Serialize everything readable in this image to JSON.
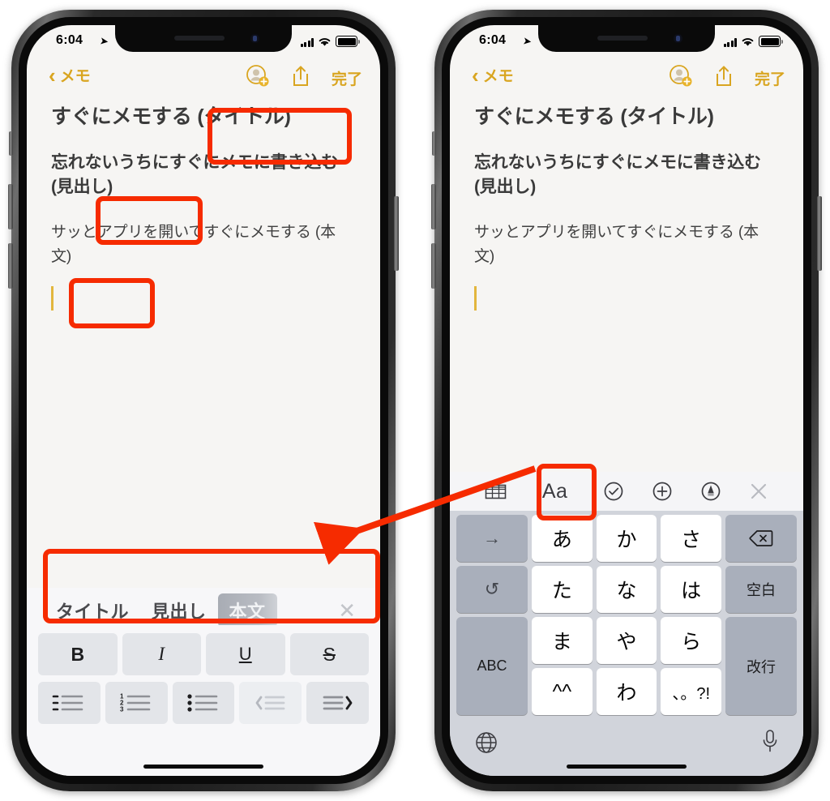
{
  "meta": {
    "device": "iPhone X",
    "app": "メモ",
    "accent_color": "#d9a520",
    "highlight_color": "#f62b00",
    "screens": 2
  },
  "status_bar": {
    "time": "6:04",
    "location_icon": "location-arrow-icon",
    "signal_icon": "cellular-bars-icon",
    "wifi_icon": "wifi-icon",
    "battery_icon": "battery-full-icon"
  },
  "nav_bar": {
    "back_label": "メモ",
    "back_icon": "chevron-left-icon",
    "add_person_icon": "person-add-icon",
    "share_icon": "share-icon",
    "done_label": "完了"
  },
  "note": {
    "title": "すぐにメモする (タイトル)",
    "heading": "忘れないうちにすぐにメモに書き込む (見出し)",
    "body": "サッとアプリを開いてすぐにメモする (本文)",
    "caret": "text-caret"
  },
  "left_screen": {
    "format_bar": {
      "styles": [
        {
          "label": "タイトル",
          "selected": false
        },
        {
          "label": "見出し",
          "selected": false
        },
        {
          "label": "本文",
          "selected": true
        }
      ],
      "close_icon": "close-icon"
    },
    "style_keyboard": {
      "row1": [
        {
          "label": "B",
          "name": "bold-button",
          "style": "bold"
        },
        {
          "label": "I",
          "name": "italic-button",
          "style": "italic"
        },
        {
          "label": "U",
          "name": "underline-button",
          "style": "underline"
        },
        {
          "label": "S",
          "name": "strikethrough-button",
          "style": "strike"
        }
      ],
      "row2": [
        {
          "name": "bulleted-list-button",
          "icon": "dash-list-icon"
        },
        {
          "name": "numbered-list-button",
          "icon": "numbered-list-icon"
        },
        {
          "name": "dotted-list-button",
          "icon": "bullet-list-icon"
        },
        {
          "name": "outdent-button",
          "icon": "indent-left-icon"
        },
        {
          "name": "indent-button",
          "icon": "indent-right-icon"
        }
      ]
    }
  },
  "right_screen": {
    "accessory_bar": [
      {
        "name": "table-button",
        "icon": "table-icon",
        "label": ""
      },
      {
        "name": "text-format-button",
        "icon": "aa-icon",
        "label": "Aa"
      },
      {
        "name": "checklist-button",
        "icon": "check-circle-icon",
        "label": ""
      },
      {
        "name": "add-attachment-button",
        "icon": "plus-circle-icon",
        "label": ""
      },
      {
        "name": "markup-button",
        "icon": "pen-circle-icon",
        "label": ""
      },
      {
        "name": "dismiss-keyboard-button",
        "icon": "close-icon",
        "label": ""
      }
    ],
    "keyboard": {
      "left_column": [
        {
          "label": "→",
          "name": "next-candidate-key"
        },
        {
          "label": "↺",
          "name": "undo-key"
        },
        {
          "label": "ABC",
          "name": "abc-key"
        }
      ],
      "kana_keys": [
        [
          "あ",
          "か",
          "さ"
        ],
        [
          "た",
          "な",
          "は"
        ],
        [
          "ま",
          "や",
          "ら"
        ],
        [
          "^^",
          "わ",
          "、。?!"
        ]
      ],
      "right_column": [
        {
          "label": "⌫",
          "name": "delete-key"
        },
        {
          "label": "空白",
          "name": "space-key"
        },
        {
          "label": "改行",
          "name": "return-key"
        }
      ],
      "bottom": {
        "globe_icon": "globe-icon",
        "mic_icon": "microphone-icon"
      }
    }
  },
  "annotations": {
    "highlights": [
      {
        "name": "highlight-title-label",
        "target": "(タイトル)"
      },
      {
        "name": "highlight-heading-label",
        "target": "(見出し)"
      },
      {
        "name": "highlight-body-label",
        "target": "(本文)"
      },
      {
        "name": "highlight-format-bar",
        "target": "タイトル 見出し 本文"
      },
      {
        "name": "highlight-aa-button",
        "target": "Aa"
      }
    ],
    "arrow": {
      "name": "instruction-arrow",
      "from": "Aa button (right screen)",
      "to": "format bar (left screen)",
      "color": "#f62b00"
    }
  }
}
